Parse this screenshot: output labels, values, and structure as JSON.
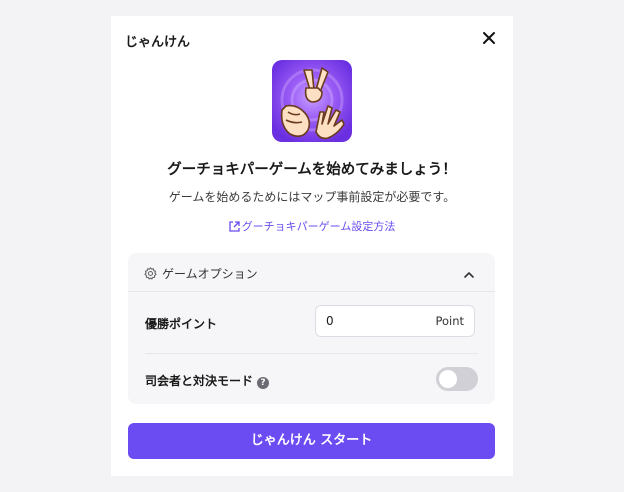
{
  "header": {
    "title": "じゃんけん",
    "close_icon": "close-icon"
  },
  "hero": {
    "icon": "rock-paper-scissors-hands-icon",
    "headline": "グーチョキパーゲームを始めてみましょう！",
    "subtext": "ゲームを始めるためにはマップ事前設定が必要です。",
    "link_icon": "external-link-icon",
    "link_text": "グーチョキパーゲーム設定方法"
  },
  "options": {
    "title": "ゲームオプション",
    "icon": "gear-icon",
    "expanded": true,
    "victory_points": {
      "label": "優勝ポイント",
      "value": "0",
      "unit": "Point"
    },
    "host_mode": {
      "label": "司会者と対決モード",
      "help_icon": "help-icon",
      "enabled": false
    }
  },
  "start_button": {
    "label": "じゃんけん スタート"
  },
  "colors": {
    "accent": "#6b4bf2",
    "link": "#6a4cf0",
    "icon_bg": "#7a3df0"
  }
}
